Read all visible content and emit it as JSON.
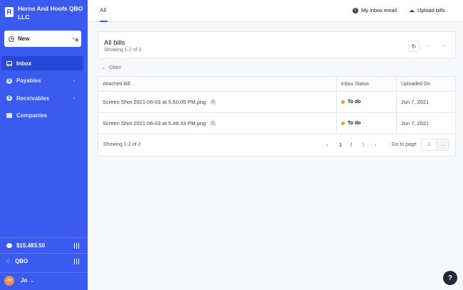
{
  "company": {
    "logo_letter": "R",
    "name": "Horns And Hoofs QBO LLC"
  },
  "new_button": {
    "label": "New"
  },
  "nav": {
    "inbox": "Inbox",
    "payables": "Payables",
    "receivables": "Receivables",
    "companies": "Companies"
  },
  "sidebar_bottom": {
    "balance": "$15,483.50",
    "integration": "QBO",
    "user_initials": "JM",
    "user_name": "Jo"
  },
  "topbar": {
    "tab_all": "All",
    "inbox_email": "My inbox email",
    "upload_bills": "Upload bills"
  },
  "card": {
    "title": "All bills",
    "subtitle": "Showing 1-2 of 2"
  },
  "group_label": "Older",
  "table": {
    "headers": {
      "attached_bill": "Attached Bill",
      "inbox_status": "Inbox Status",
      "uploaded_on": "Uploaded On"
    },
    "rows": [
      {
        "file": "Screen Shot 2021-06-03 at 5.50.05 PM.png",
        "status": "To do",
        "uploaded": "Jun 7, 2021"
      },
      {
        "file": "Screen Shot 2021-06-03 at 5.49.33 PM.png",
        "status": "To do",
        "uploaded": "Jun 7, 2021"
      }
    ]
  },
  "pagination": {
    "showing": "Showing 1-2 of 2",
    "current_page": "1",
    "separator": "/",
    "total_pages": "1",
    "goto_label": "Go to page",
    "goto_placeholder": "1"
  },
  "help_label": "?",
  "colors": {
    "sidebar": "#3b5bf0",
    "active_nav": "#2748d6",
    "status_todo": "#f59e0b"
  }
}
